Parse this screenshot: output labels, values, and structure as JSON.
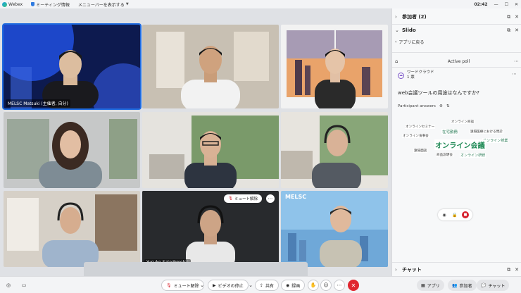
{
  "titlebar": {
    "app_name": "Webex",
    "meeting_info": "ミーティング情報",
    "menu_bar": "メニューバーを表示する",
    "time": "02:42"
  },
  "participants": [
    {
      "name": "MELSC Matsuki (主催者, 自分)",
      "active": true
    },
    {
      "name": ""
    },
    {
      "name": ""
    },
    {
      "name": ""
    },
    {
      "name": ""
    },
    {
      "name": ""
    },
    {
      "name": ""
    },
    {
      "name": "Yusuke Sato@melsc",
      "unmute_label": "ミュート解除"
    },
    {
      "name": "",
      "watermark": "MELSC"
    }
  ],
  "panel": {
    "participants_header": "参加者 (2)",
    "slido_header": "Slido",
    "back_label": "アプリに戻る",
    "active_poll": "Active poll",
    "poll_type": "ワードクラウド",
    "poll_count": "1 票",
    "question": "web会議ツールの用途はなんですか?",
    "answers_label": "Participant answers",
    "chat_header": "チャット"
  },
  "word_cloud": [
    {
      "text": "オンライン商談",
      "color": "#333333",
      "weight": 1
    },
    {
      "text": "オンラインセミナー",
      "color": "#333333",
      "weight": 1
    },
    {
      "text": "在宅勤務",
      "color": "#2a7b57",
      "weight": 1.2
    },
    {
      "text": "遠隔医療における問診",
      "color": "#333333",
      "weight": 1
    },
    {
      "text": "オンライン食事会",
      "color": "#333333",
      "weight": 1
    },
    {
      "text": "オンライン授業",
      "color": "#2a7b57",
      "weight": 1.1
    },
    {
      "text": "オンライン会議",
      "color": "#1f8a55",
      "weight": 2.2
    },
    {
      "text": "遠隔面談",
      "color": "#333333",
      "weight": 1
    },
    {
      "text": "商品説明会",
      "color": "#333333",
      "weight": 1
    },
    {
      "text": "オンライン研修",
      "color": "#2a7b57",
      "weight": 1.1
    }
  ],
  "bottombar": {
    "unmute": "ミュート解除",
    "stop_video": "ビデオの停止",
    "share": "共有",
    "record": "録画",
    "apps": "アプリ",
    "participants": "参加者",
    "chat": "チャット"
  },
  "colors": {
    "accent": "#1f6be0",
    "leave": "#e0262f",
    "poll_green": "#1f8a55"
  }
}
